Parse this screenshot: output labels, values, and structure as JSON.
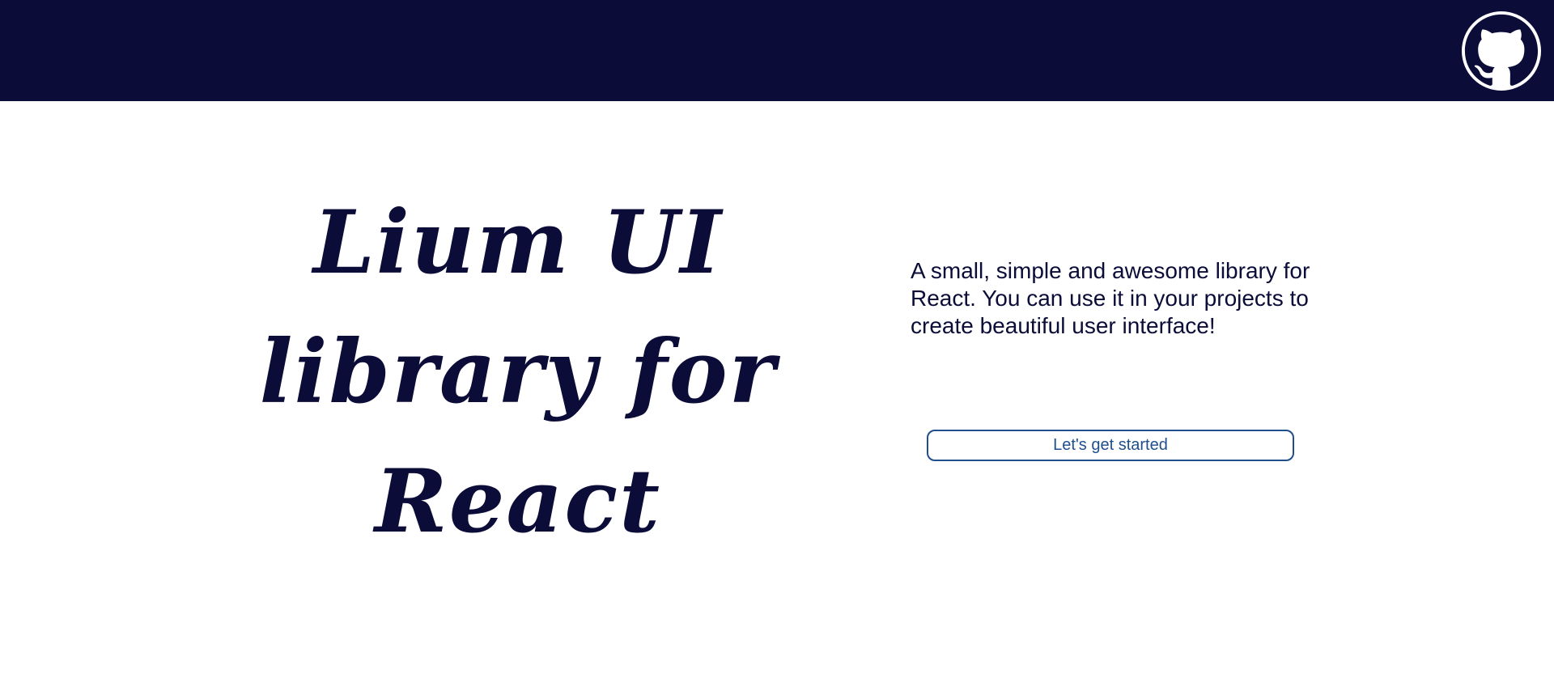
{
  "colors": {
    "navy": "#0b0c38",
    "accent": "#1f4f8c",
    "background": "#ffffff"
  },
  "header": {
    "github_icon": "github-octocat-icon"
  },
  "hero": {
    "title": "Lium UI library for React",
    "description": "A small, simple and awesome library for React. You can use it in your projects to create beautiful user interface!",
    "cta_label": "Let's get started"
  }
}
